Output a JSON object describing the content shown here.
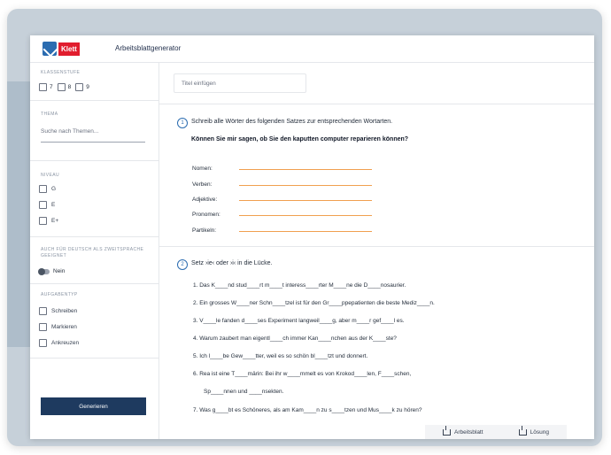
{
  "header": {
    "logo_text": "Klett",
    "app_title": "Arbeitsblattgenerator"
  },
  "sidebar": {
    "grade": {
      "label": "KLASSENSTUFE",
      "options": [
        "7",
        "8",
        "9"
      ]
    },
    "theme": {
      "label": "THEMA",
      "search_placeholder": "Suche nach Themen..."
    },
    "level": {
      "label": "NIVEAU",
      "options": [
        "G",
        "E",
        "E+"
      ]
    },
    "daz": {
      "label": "AUCH FÜR DEUTSCH ALS ZWEITSPRACHE GEEIGNET",
      "toggle_label": "Nein"
    },
    "task": {
      "label": "AUFGABENTYP",
      "options": [
        "Schreiben",
        "Markieren",
        "Ankreuzen"
      ]
    },
    "generate_label": "Generieren"
  },
  "main": {
    "title_placeholder": "Titel einfügen",
    "q1": {
      "number": "1",
      "instruction": "Schreib alle Wörter des folgenden Satzes zur entsprechenden Wortarten.",
      "sentence": "Können Sie mir sagen, ob Sie den kaputten computer reparieren können?",
      "categories": [
        "Nomen:",
        "Verben:",
        "Adjektive:",
        "Pronomen:",
        "Partikeln:"
      ]
    },
    "q2": {
      "number": "2",
      "instruction": "Setz ›ie‹ oder ›i‹ in die Lücke.",
      "sentences": [
        "1. Das K____nd stud____rt m____t interess____rter M____ne die D____nosaurier.",
        "2. Ein grosses W____ner Schn____tzel ist für den Gr____ppepatienten die beste Mediz____n.",
        "3. V____le fanden d____ses Experiment langweil____g, aber m____r gef____l es.",
        "4. Warum zaubert man eigentl____ch immer Kan____nchen aus der K____ste?",
        "5. Ich l____be Gew____tter, weil es so schön bl____tzt und donnert.",
        "6. Rea ist eine T____märin: Bei ihr w____mmelt es von Krokod____len, F____schen,",
        "Sp____nnen und ____nsekten.",
        "7. Was g____bt es Schöneres, als am Kam____n zu s____tzen und Mus____k zu hören?"
      ]
    },
    "download": {
      "worksheet": "Arbeitsblatt",
      "solution": "Lösung"
    }
  }
}
